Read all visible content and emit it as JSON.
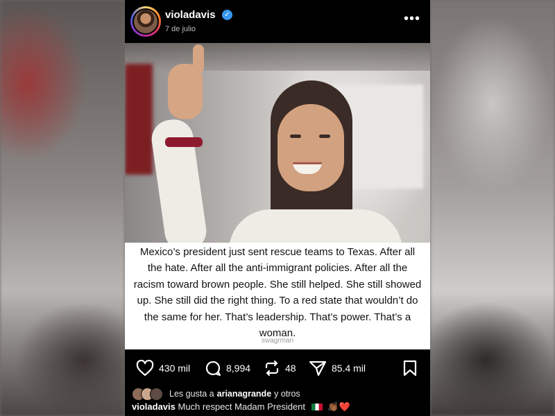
{
  "post": {
    "username": "violadavis",
    "verified_icon": "✓",
    "date": "7 de julio",
    "more_icon": "•••",
    "caption": "Mexico’s president just sent rescue teams to Texas. After all the hate. After all the anti-immigrant policies. After all the racism toward brown people. She still helped. She still showed up. She still did the right thing. To a red state that wouldn’t do the same for her. That’s leadership. That’s power. That’s a woman.",
    "watermark": "swagrman"
  },
  "actions": {
    "likes_count": "430 mil",
    "comments_count": "8,994",
    "reposts_count": "48",
    "shares_count": "85.4 mil",
    "icons": [
      "heart-icon",
      "comment-icon",
      "repost-icon",
      "send-icon",
      "bookmark-icon"
    ]
  },
  "liked_by": {
    "prefix": "Les gusta a",
    "user": "arianagrande",
    "suffix": "y otros"
  },
  "comment": {
    "user": "violadavis",
    "text": "Much respect Madam President",
    "emojis": "👏🏾❤️"
  },
  "colors": {
    "background": "#000000",
    "caption_bg": "#ffffff",
    "verified": "#3897f0",
    "text": "#ffffff"
  }
}
